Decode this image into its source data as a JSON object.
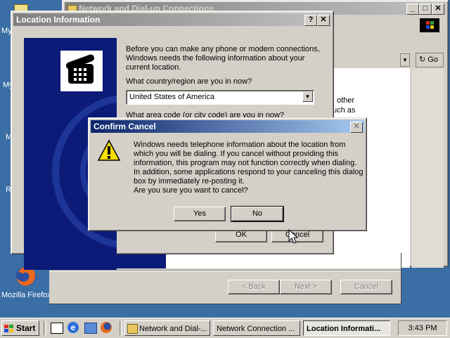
{
  "desktop": {
    "labels": [
      "My",
      "My",
      "M",
      "R"
    ],
    "firefox_label": "Mozilla Firefox"
  },
  "network_window": {
    "title": "Network and Dial-up Connections",
    "go_label": "Go",
    "side_text_1": "other",
    "side_text_2": "uch as",
    "buttons": {
      "back": "< Back",
      "next": "Next >",
      "cancel": "Cancel"
    }
  },
  "location_dialog": {
    "title": "Location Information",
    "intro": "Before you can make any phone or modem connections, Windows needs the following information about your current location.",
    "country_label": "What country/region are you in now?",
    "country_value": "United States of America",
    "area_label": "What area code (or city code) are you in now?",
    "ok": "OK",
    "cancel": "Cancel"
  },
  "confirm_dialog": {
    "title": "Confirm Cancel",
    "message_lines": [
      "Windows needs telephone information about the location from",
      "which you will be dialing. If you cancel without providing this",
      "information, this program may not function correctly when dialing.",
      "In addition, some applications respond to your canceling this dialog",
      "box by immediately re-posting it.",
      "Are you sure you want to cancel?"
    ],
    "yes": "Yes",
    "no": "No"
  },
  "taskbar": {
    "start": "Start",
    "tasks": [
      "Network and Dial-...",
      "Network Connection ...",
      "Location Informati..."
    ],
    "clock": "3:43 PM"
  },
  "colors": {
    "desktop": "#3a6ea5",
    "title_active": "#0a246a",
    "face": "#d4d0c8"
  }
}
